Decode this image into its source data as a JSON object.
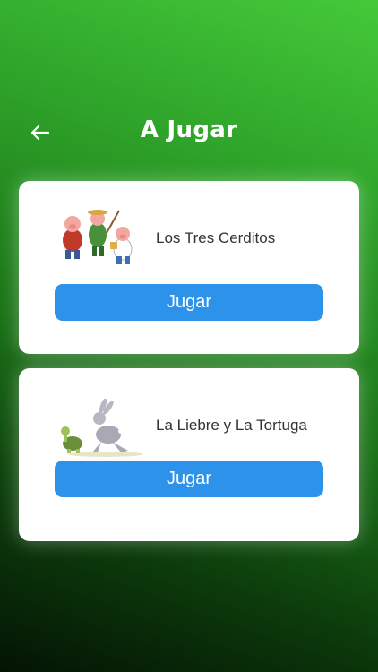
{
  "header": {
    "title": "A Jugar",
    "back_icon": "arrow-left-icon"
  },
  "stories": [
    {
      "title": "Los Tres Cerditos",
      "button_label": "Jugar",
      "image": "three-little-pigs-illustration"
    },
    {
      "title": "La Liebre y La Tortuga",
      "button_label": "Jugar",
      "image": "hare-and-tortoise-illustration"
    }
  ],
  "colors": {
    "button": "#2d93ea",
    "background_top": "#45c93a",
    "background_bottom": "#041404",
    "card": "#ffffff"
  }
}
